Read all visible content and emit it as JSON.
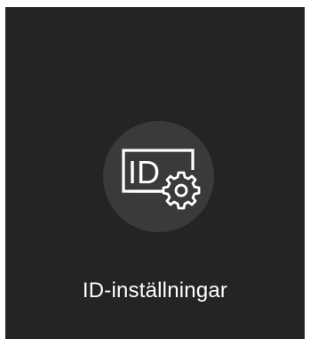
{
  "menu_item": {
    "label": "ID-inställningar",
    "icon_name": "id-settings-icon",
    "icon_text": "ID"
  },
  "colors": {
    "tile_background": "#252423",
    "icon_circle": "#3b3a39",
    "foreground": "#ffffff"
  }
}
